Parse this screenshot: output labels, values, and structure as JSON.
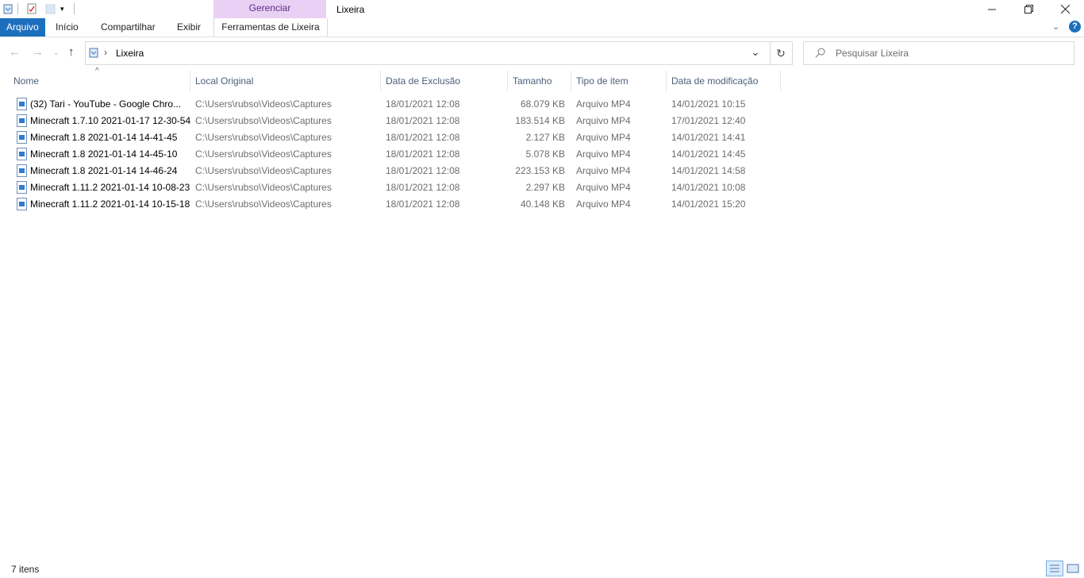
{
  "window": {
    "title": "Lixeira",
    "contextual_group": "Gerenciar",
    "controls": [
      "minimize",
      "restore",
      "close"
    ]
  },
  "quick_access": {
    "icons": [
      "recycle-bin-icon",
      "properties-icon",
      "new-folder-icon",
      "qat-dropdown-icon"
    ]
  },
  "ribbon": {
    "file_tab": "Arquivo",
    "tabs": [
      "Início",
      "Compartilhar",
      "Exibir"
    ],
    "tools_tab": "Ferramentas de Lixeira",
    "help": "?"
  },
  "address": {
    "separator": "›",
    "location": "Lixeira",
    "search_placeholder": "Pesquisar Lixeira"
  },
  "columns": [
    "Nome",
    "Local Original",
    "Data de Exclusão",
    "Tamanho",
    "Tipo de item",
    "Data de modificação"
  ],
  "rows": [
    {
      "name": "(32) Tari - YouTube - Google Chro...",
      "origin": "C:\\Users\\rubso\\Videos\\Captures",
      "deleted": "18/01/2021 12:08",
      "size": "68.079 KB",
      "type": "Arquivo MP4",
      "modified": "14/01/2021 10:15"
    },
    {
      "name": "Minecraft 1.7.10 2021-01-17 12-30-54",
      "origin": "C:\\Users\\rubso\\Videos\\Captures",
      "deleted": "18/01/2021 12:08",
      "size": "183.514 KB",
      "type": "Arquivo MP4",
      "modified": "17/01/2021 12:40"
    },
    {
      "name": "Minecraft 1.8 2021-01-14 14-41-45",
      "origin": "C:\\Users\\rubso\\Videos\\Captures",
      "deleted": "18/01/2021 12:08",
      "size": "2.127 KB",
      "type": "Arquivo MP4",
      "modified": "14/01/2021 14:41"
    },
    {
      "name": "Minecraft 1.8 2021-01-14 14-45-10",
      "origin": "C:\\Users\\rubso\\Videos\\Captures",
      "deleted": "18/01/2021 12:08",
      "size": "5.078 KB",
      "type": "Arquivo MP4",
      "modified": "14/01/2021 14:45"
    },
    {
      "name": "Minecraft 1.8 2021-01-14 14-46-24",
      "origin": "C:\\Users\\rubso\\Videos\\Captures",
      "deleted": "18/01/2021 12:08",
      "size": "223.153 KB",
      "type": "Arquivo MP4",
      "modified": "14/01/2021 14:58"
    },
    {
      "name": "Minecraft 1.11.2 2021-01-14 10-08-23",
      "origin": "C:\\Users\\rubso\\Videos\\Captures",
      "deleted": "18/01/2021 12:08",
      "size": "2.297 KB",
      "type": "Arquivo MP4",
      "modified": "14/01/2021 10:08"
    },
    {
      "name": "Minecraft 1.11.2 2021-01-14 10-15-18",
      "origin": "C:\\Users\\rubso\\Videos\\Captures",
      "deleted": "18/01/2021 12:08",
      "size": "40.148 KB",
      "type": "Arquivo MP4",
      "modified": "14/01/2021 15:20"
    }
  ],
  "status": {
    "count": "7 itens"
  },
  "colors": {
    "file_tab_bg": "#1c6fbd",
    "manage_tab_bg": "#e9d0f5",
    "manage_tab_text": "#5c2d83",
    "header_text": "#4c607a",
    "help_bg": "#1c6fbd"
  }
}
